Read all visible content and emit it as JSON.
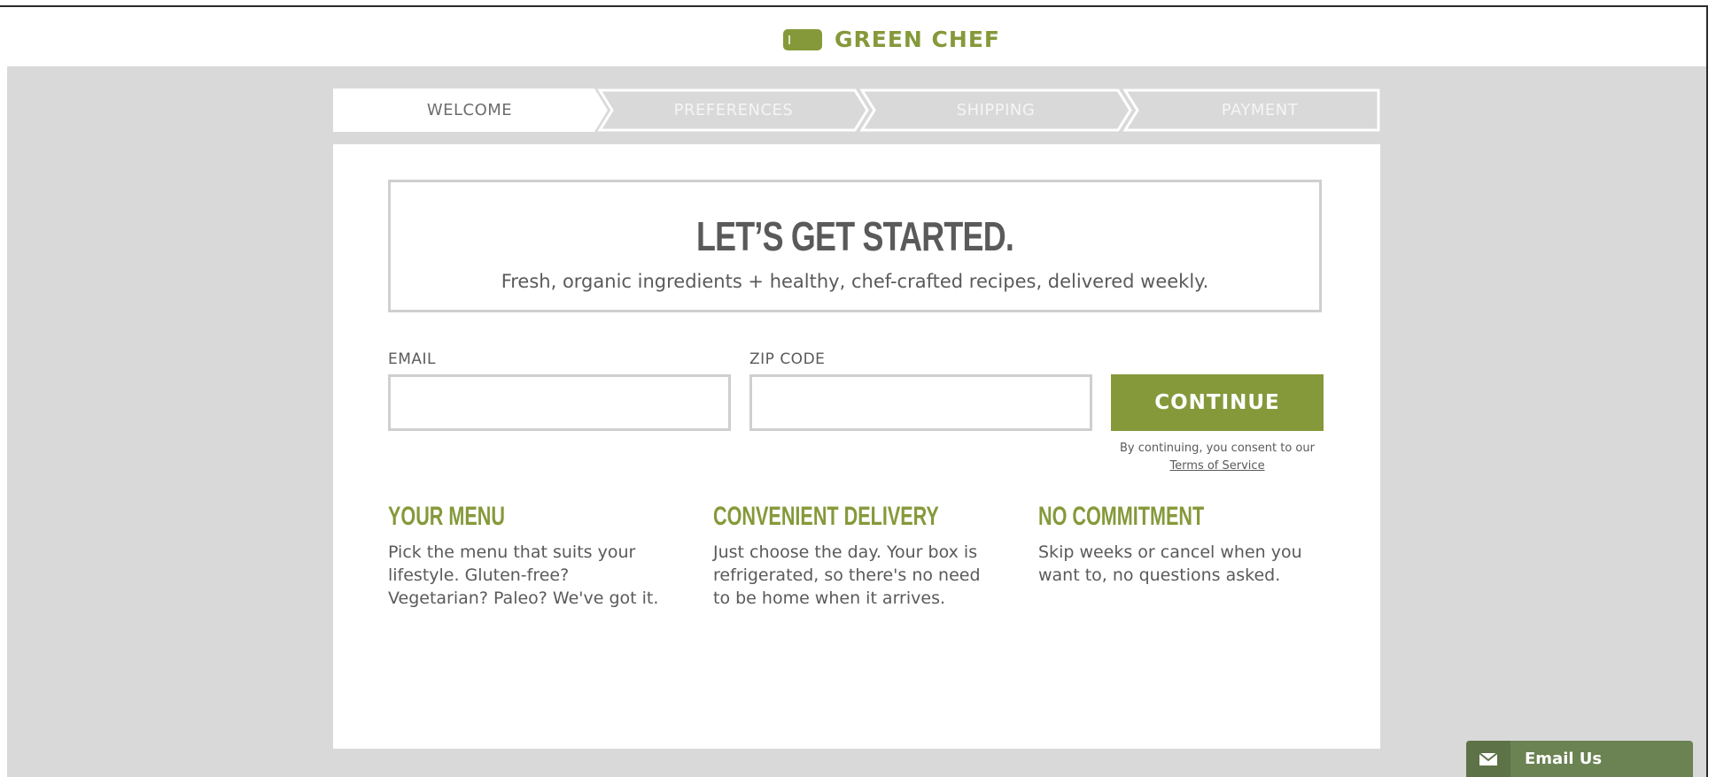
{
  "header": {
    "brand": "GREEN CHEF",
    "brand_color": "#85993a"
  },
  "steps": [
    {
      "label": "WELCOME",
      "active": true
    },
    {
      "label": "PREFERENCES",
      "active": false
    },
    {
      "label": "SHIPPING",
      "active": false
    },
    {
      "label": "PAYMENT",
      "active": false
    }
  ],
  "hero": {
    "title": "LET’S GET STARTED.",
    "subtitle": "Fresh, organic ingredients + healthy, chef-crafted recipes, delivered weekly."
  },
  "form": {
    "email_label": "EMAIL",
    "email_value": "",
    "zip_label": "ZIP CODE",
    "zip_value": "",
    "continue_label": "CONTINUE",
    "consent_text": "By continuing, you consent to our",
    "terms_link": "Terms of Service"
  },
  "features": [
    {
      "title": "YOUR MENU",
      "text": "Pick the menu that suits your lifestyle. Gluten-free? Vegetarian? Paleo? We've got it."
    },
    {
      "title": "CONVENIENT DELIVERY",
      "text": "Just choose the day. Your box is refrigerated, so there's no need to be home when it arrives."
    },
    {
      "title": "NO COMMITMENT",
      "text": "Skip weeks or cancel when you want to, no questions asked."
    }
  ],
  "email_widget": {
    "label": "Email Us",
    "icon": "envelope-icon",
    "color": "#6b8252"
  }
}
